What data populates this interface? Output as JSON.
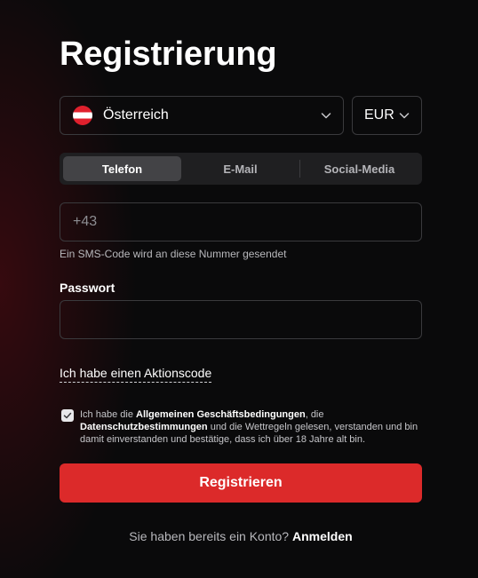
{
  "page": {
    "title": "Registrierung"
  },
  "country_select": {
    "value": "Österreich",
    "flag": "austria-flag-icon"
  },
  "currency_select": {
    "value": "EUR"
  },
  "tabs": [
    {
      "label": "Telefon",
      "active": true
    },
    {
      "label": "E-Mail",
      "active": false
    },
    {
      "label": "Social-Media",
      "active": false
    }
  ],
  "phone": {
    "placeholder": "+43",
    "hint": "Ein SMS-Code wird an diese Nummer gesendet"
  },
  "password": {
    "label": "Passwort",
    "value": ""
  },
  "promo": {
    "label": "Ich habe einen Aktionscode"
  },
  "terms": {
    "checked": true,
    "prefix": "Ich habe die ",
    "link1": "Allgemeinen Geschäftsbedingungen",
    "mid1": ", die ",
    "link2": "Datenschutzbestimmungen",
    "suffix": " und die Wettregeln gelesen, verstanden und bin damit einverstanden und bestätige, dass ich über 18 Jahre alt bin."
  },
  "submit": {
    "label": "Registrieren"
  },
  "login": {
    "text": "Sie haben bereits ein Konto?",
    "link": "Anmelden"
  },
  "colors": {
    "background": "#0a0a0b",
    "accent": "#dc2a2a",
    "border": "#3a3a3d",
    "tab_bg": "#1f1f21",
    "tab_active": "#434346"
  }
}
